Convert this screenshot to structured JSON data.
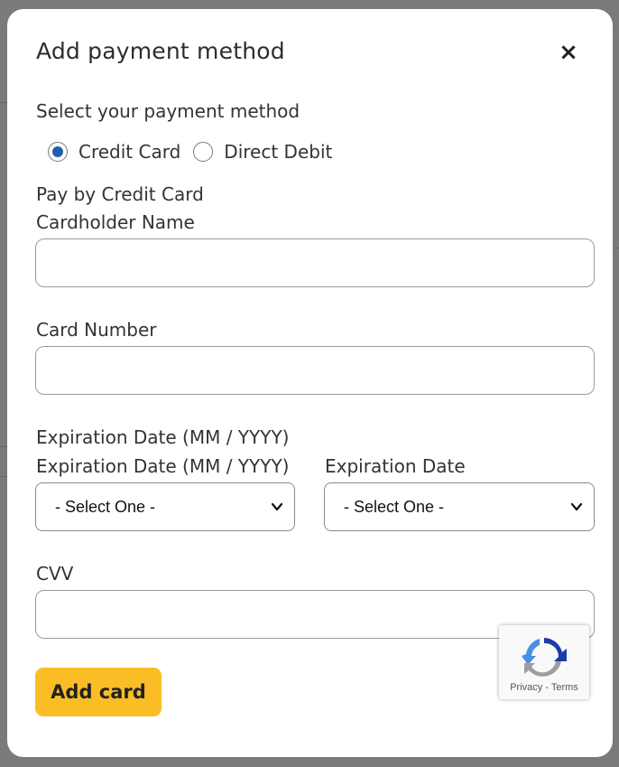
{
  "modal": {
    "title": "Add payment method",
    "close_symbol": "×"
  },
  "payment": {
    "select_label": "Select your payment method",
    "options": [
      {
        "label": "Credit Card",
        "selected": true
      },
      {
        "label": "Direct Debit",
        "selected": false
      }
    ],
    "pay_by_label": "Pay by Credit Card"
  },
  "fields": {
    "cardholder_label": "Cardholder Name",
    "cardholder_value": "",
    "card_number_label": "Card Number",
    "card_number_value": "",
    "expiration_heading": "Expiration Date (MM / YYYY)",
    "expiration_month_label": "Expiration Date (MM / YYYY)",
    "expiration_year_label": "Expiration Date",
    "month_select_value": "- Select One -",
    "year_select_value": "- Select One -",
    "cvv_label": "CVV",
    "cvv_value": ""
  },
  "actions": {
    "add_card_label": "Add card"
  },
  "recaptcha": {
    "privacy": "Privacy",
    "separator": "-",
    "terms": "Terms"
  },
  "colors": {
    "accent_button": "#fbbd26",
    "radio_selected": "#1f5fae",
    "overlay": "#6f6f6f"
  }
}
